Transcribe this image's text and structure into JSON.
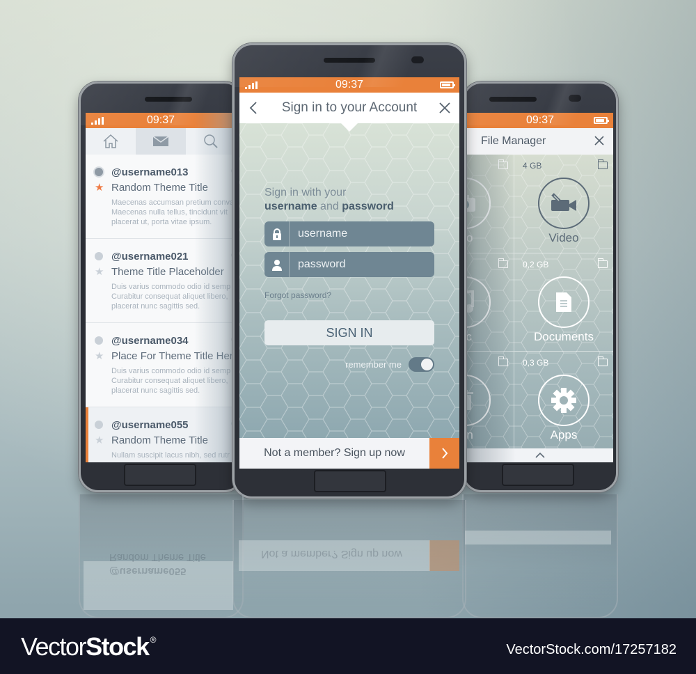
{
  "status": {
    "time": "09:37"
  },
  "colors": {
    "accent": "#e9813a",
    "text_dark": "#4b5a6a",
    "field_bg": "#6f8693",
    "watermark_bg": "#121424"
  },
  "left_phone": {
    "tabs": [
      {
        "name": "home",
        "icon": "home-icon"
      },
      {
        "name": "mail",
        "icon": "mail-icon",
        "active": true
      },
      {
        "name": "search",
        "icon": "search-icon"
      }
    ],
    "messages": [
      {
        "user": "@username013",
        "title": "Random Theme Title",
        "starred": true,
        "read": true,
        "body": [
          "Maecenas accumsan pretium conva",
          "Maecenas nulla tellus, tincidunt vit",
          "placerat ut, porta vitae ipsum."
        ]
      },
      {
        "user": "@username021",
        "title": "Theme Title Placeholder",
        "starred": false,
        "read": false,
        "body": [
          "Duis varius commodo odio id semp",
          "Curabitur consequat aliquet libero,",
          "placerat nunc sagittis sed."
        ]
      },
      {
        "user": "@username034",
        "title": "Place For Theme Title Her",
        "starred": false,
        "read": false,
        "body": [
          "Duis varius commodo odio id semp",
          "Curabitur consequat aliquet libero,",
          "placerat nunc sagittis sed."
        ]
      },
      {
        "user": "@username055",
        "title": "Random Theme Title",
        "starred": false,
        "read": false,
        "highlighted": true,
        "body": [
          "Nullam suscipit lacus nibh, sed rutr"
        ]
      }
    ]
  },
  "center_phone": {
    "header_title": "Sign in to your Account",
    "prompt_line1": "Sign in with your",
    "prompt_bold1": "username",
    "prompt_and": " and ",
    "prompt_bold2": "password",
    "username_placeholder": "username",
    "password_placeholder": "password",
    "forgot_password": "Forgot password?",
    "sign_in_button": "SIGN IN",
    "remember_me": "remember me",
    "remember_me_on": true,
    "signup_text": "Not a member? Sign up now"
  },
  "right_phone": {
    "header_title": "File Manager",
    "tiles": [
      {
        "label": "oto",
        "size": "",
        "icon": "camera-icon"
      },
      {
        "label": "Video",
        "size": "4 GB",
        "icon": "video-camera-icon"
      },
      {
        "label": "sic",
        "size": "",
        "icon": "music-icon"
      },
      {
        "label": "Documents",
        "size": "0,2 GB",
        "icon": "document-icon"
      },
      {
        "label": "Bin",
        "size": "",
        "icon": "trash-icon"
      },
      {
        "label": "Apps",
        "size": "0,3 GB",
        "icon": "gear-icon"
      }
    ]
  },
  "watermark": {
    "logo_light": "Vector",
    "logo_bold": "Stock",
    "logo_mark": "®",
    "url": "VectorStock.com/17257182"
  }
}
